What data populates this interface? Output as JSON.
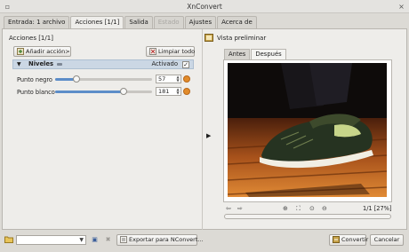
{
  "window": {
    "title": "XnConvert"
  },
  "tabs": [
    {
      "label": "Entrada: 1 archivo"
    },
    {
      "label": "Acciones [1/1]"
    },
    {
      "label": "Salida"
    },
    {
      "label": "Estado"
    },
    {
      "label": "Ajustes"
    },
    {
      "label": "Acerca de"
    }
  ],
  "actions": {
    "heading": "Acciones [1/1]",
    "add_button": "Añadir acción>",
    "clear_button": "Limpiar todo",
    "levels": {
      "title": "Niveles",
      "collapse_glyph": "▼",
      "enabled_label": "Activado",
      "enabled": true,
      "check_glyph": "✓"
    },
    "black_point": {
      "label": "Punto negro",
      "value": "57",
      "level": 0.22
    },
    "white_point": {
      "label": "Punto blanco",
      "value": "181",
      "level": 0.71
    }
  },
  "preview": {
    "title": "Vista preliminar",
    "tabs": [
      {
        "label": "Antes"
      },
      {
        "label": "Después"
      }
    ],
    "zoom_label": "1/1 [27%]"
  },
  "bottom": {
    "export_button": "Exportar para NConvert...",
    "convert_button": "Convertir",
    "cancel_button": "Cancelar"
  },
  "colors": {
    "accent": "#5c8dc8",
    "orange_icon": "#e28b2a",
    "level_header": "#cbd7e4"
  }
}
